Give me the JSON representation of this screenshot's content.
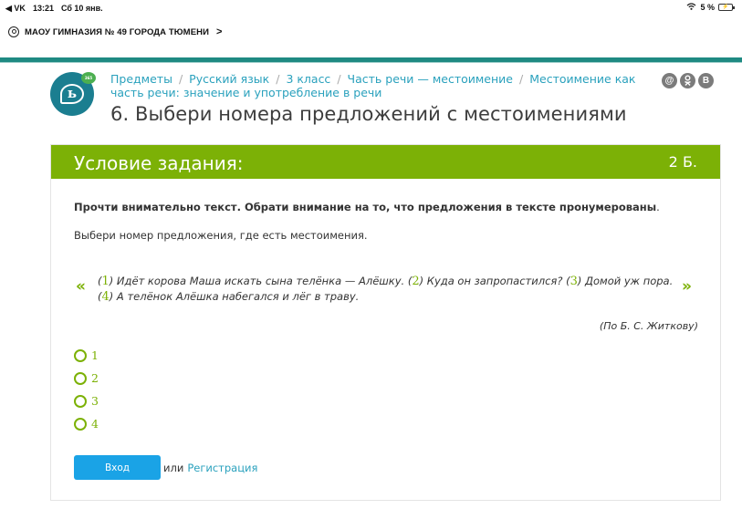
{
  "status_bar": {
    "carrier": "◀ VK",
    "time": "13:21",
    "date": "Сб 10 янв.",
    "battery": "5 %"
  },
  "school": {
    "name": "МАОУ ГИМНАЗИЯ № 49 ГОРОДА ТЮМЕНИ",
    "chevron": ">"
  },
  "logo": {
    "glyph": "ь",
    "badge": "365"
  },
  "breadcrumb": [
    "Предметы",
    "Русский язык",
    "3 класс",
    "Часть речи — местоимение",
    "Местоимение как часть речи: значение и употребление в речи"
  ],
  "share": [
    "@",
    "ok",
    "B"
  ],
  "page_title": "6. Выбери номера предложений с местоимениями",
  "task": {
    "header_title": "Условие задания:",
    "points": "2 Б.",
    "instruction_bold": "Прочти внимательно текст. Обрати внимание на то, что предложения в тексте пронумерованы",
    "instruction_dot": ".",
    "instruction_plain": "Выбери номер предложения, где есть местоимения.",
    "nav_prev": "«",
    "nav_next": "»",
    "passage": [
      {
        "num": "1",
        "text": " Идёт корова Маша искать сына телёнка — Алёшку. "
      },
      {
        "num": "2",
        "text": " Куда он запропастился? "
      },
      {
        "num": "3",
        "text": " Домой уж пора. "
      },
      {
        "num": "4",
        "text": " А телёнок Алёшка набегался и лёг в траву."
      }
    ],
    "source": "(По Б. С. Житкову)",
    "options": [
      "1",
      "2",
      "3",
      "4"
    ]
  },
  "auth": {
    "login_label": "Вход",
    "or_label": "или",
    "register_label": "Регистрация"
  },
  "colors": {
    "accent_green": "#7cb106",
    "link_blue": "#2aa1bd",
    "button_blue": "#1aa3e6",
    "stripe_teal": "#1f8a82"
  }
}
